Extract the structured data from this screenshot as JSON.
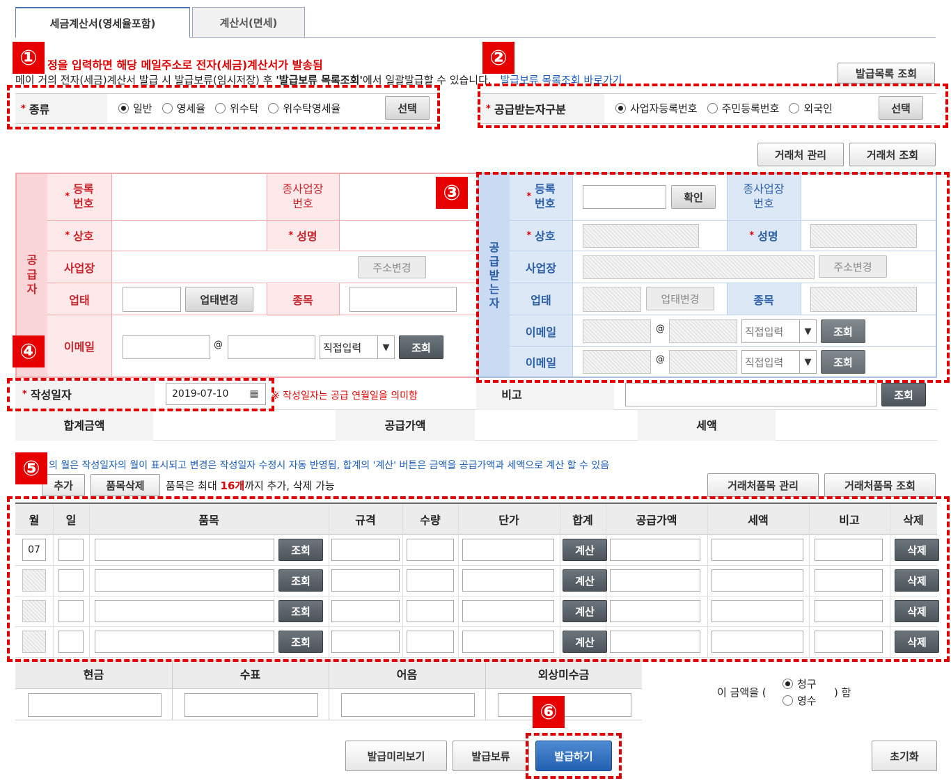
{
  "tabs": [
    "세금계산서(영세율포함)",
    "계산서(면세)"
  ],
  "notice_red": "정을 입력하면 해당 메일주소로 전자(세금)계산서가 발송됨",
  "notice_line": {
    "prefix": "메이 거의 전자(세금)계산서 발급 시 발급보류(임시저장) 후 ",
    "bold": "'발급보류 목록조회'",
    "suffix": "에서 일괄발급할 수 있습니다.",
    "link": "발급보류 목록조회 바로가기"
  },
  "issue_list_button": "발급목록 조회",
  "type_row": {
    "label": "종류",
    "options": [
      "일반",
      "영세율",
      "위수탁",
      "위수탁영세율"
    ],
    "selected": "일반",
    "button": "선택"
  },
  "recipient_type": {
    "label": "공급받는자구분",
    "options": [
      "사업자등록번호",
      "주민등록번호",
      "외국인"
    ],
    "selected": "사업자등록번호",
    "button": "선택"
  },
  "partner_buttons": [
    "거래처 관리",
    "거래처 조회"
  ],
  "supplier": {
    "side_label": "공급자",
    "reg_no_label": "등록\n번호",
    "sub_biz_label": "종사업장\n번호",
    "company_label": "상호",
    "name_label": "성명",
    "address_label": "사업장",
    "address_change": "주소변경",
    "biz_type_label": "업태",
    "biz_type_change": "업태변경",
    "item_label": "종목",
    "email_label": "이메일",
    "email_at": "@",
    "email_domain_select": "직접입력",
    "email_lookup": "조회"
  },
  "receiver": {
    "side_label": "공급받는자",
    "reg_no_label": "등록\n번호",
    "confirm": "확인",
    "sub_biz_label": "종사업장\n번호",
    "company_label": "상호",
    "name_label": "성명",
    "address_label": "사업장",
    "address_change": "주소변경",
    "biz_type_label": "업태",
    "biz_type_change": "업태변경",
    "item_label": "종목",
    "email1_label": "이메일",
    "email2_label": "이메일",
    "email_at": "@",
    "email_domain_select": "직접입력",
    "email_lookup": "조회"
  },
  "write_date": {
    "label": "작성일자",
    "value": "2019-07-10",
    "note": "※ 작성일자는 공급 연월일을 의미함",
    "remark_label": "비고",
    "remark_lookup": "조회"
  },
  "totals": {
    "sum_label": "합계금액",
    "supply_label": "공급가액",
    "tax_label": "세액"
  },
  "items_notice": "의 월은 작성일자의 월이 표시되고 변경은 작성일자 수정시 자동 반영됨, 합계의 '계산' 버튼은 금액을 공급가액과 세액으로 계산 할 수 있음",
  "items_toolbar": {
    "add": "추가",
    "delete": "품목삭제",
    "limit_prefix": "품목은 최대 ",
    "limit_count": "16개",
    "limit_suffix": "까지 추가, 삭제 가능",
    "manage": "거래처품목 관리",
    "lookup": "거래처품목 조회"
  },
  "items_table": {
    "headers": [
      "월",
      "일",
      "품목",
      "규격",
      "수량",
      "단가",
      "합계",
      "공급가액",
      "세액",
      "비고",
      "삭제"
    ],
    "rows": [
      {
        "month": "07",
        "lookup": "조회",
        "calc": "계산",
        "del": "삭제"
      },
      {
        "month": "",
        "lookup": "조회",
        "calc": "계산",
        "del": "삭제"
      },
      {
        "month": "",
        "lookup": "조회",
        "calc": "계산",
        "del": "삭제"
      },
      {
        "month": "",
        "lookup": "조회",
        "calc": "계산",
        "del": "삭제"
      }
    ]
  },
  "payment": {
    "headers": [
      "현금",
      "수표",
      "어음",
      "외상미수금"
    ],
    "amount_prefix": "이 금액을 (",
    "options": [
      "청구",
      "영수"
    ],
    "selected": "청구",
    "amount_suffix": ") 함"
  },
  "bottom_buttons": {
    "preview": "발급미리보기",
    "hold": "발급보류",
    "issue": "발급하기",
    "reset": "초기화"
  },
  "badges": [
    "①",
    "②",
    "③",
    "④",
    "⑤",
    "⑥"
  ],
  "colors": {
    "supplier_bg": "#fde9ea",
    "receiver_bg": "#dde8f7",
    "annotation_red": "#e30000",
    "issue_blue": "#2360b0"
  }
}
